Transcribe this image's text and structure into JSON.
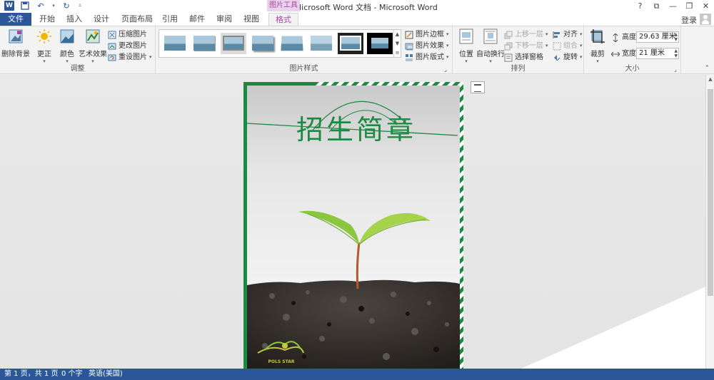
{
  "window": {
    "title": "新建 Microsoft Word 文档 - Microsoft Word",
    "context_tool": "图片工具",
    "controls": [
      "?",
      "⧉",
      "—",
      "❐",
      "✕"
    ]
  },
  "tabs": [
    {
      "label": "文件"
    },
    {
      "label": "开始"
    },
    {
      "label": "插入"
    },
    {
      "label": "设计"
    },
    {
      "label": "页面布局"
    },
    {
      "label": "引用"
    },
    {
      "label": "邮件"
    },
    {
      "label": "审阅"
    },
    {
      "label": "视图"
    },
    {
      "label": "格式"
    }
  ],
  "account": {
    "login": "登录"
  },
  "ribbon": {
    "remove_bg": "删除背景",
    "corrections": "更正",
    "color": "颜色",
    "artistic": "艺术效果",
    "compress": "压缩图片",
    "change": "更改图片",
    "reset": "重设图片",
    "adjust_label": "调整",
    "styles_label": "图片样式",
    "border": "图片边框",
    "effects": "图片效果",
    "layout": "图片版式",
    "position": "位置",
    "wrap": "自动换行",
    "bring_forward": "上移一层",
    "send_backward": "下移一层",
    "selection_pane": "选择窗格",
    "align": "对齐",
    "group": "组合",
    "rotate": "旋转",
    "arrange_label": "排列",
    "crop": "裁剪",
    "height_label": "高度:",
    "height_value": "29.63 厘米",
    "width_label": "宽度:",
    "width_value": "21 厘米",
    "size_label": "大小"
  },
  "poster": {
    "title": "招生简章",
    "logo_text": "POLS STAR"
  },
  "status": {
    "page": "第 1 页，共 1 页",
    "words": "0 个字",
    "lang": "英语(美国)"
  }
}
